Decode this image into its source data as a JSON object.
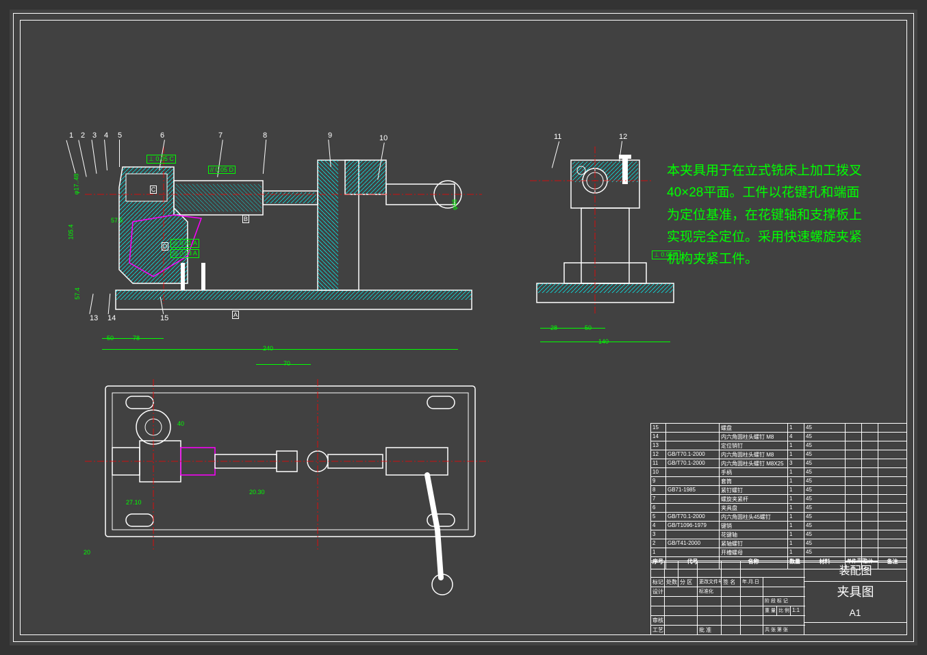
{
  "annotation": "本夹具用于在立式铣床上加工拨叉40×28平面。工件以花键孔和端面为定位基准，在花键轴和支撑板上实现完全定位。采用快速螺旋夹紧机构夹紧工件。",
  "balloons_top": [
    "1",
    "2",
    "3",
    "4",
    "5",
    "6",
    "7",
    "8",
    "9",
    "10",
    "11",
    "12"
  ],
  "balloons_bottom": [
    "13",
    "14",
    "15"
  ],
  "gd_refs": {
    "A": "A",
    "B": "B",
    "C": "C",
    "D": "D"
  },
  "tolerances": {
    "t1": "⊥ 0.05 C",
    "t2": "// 0.05 D",
    "t3": "◎ 0.01 A",
    "t4": "◎ 0.03 A",
    "t5": "⊥ 0.05 A"
  },
  "dimensions": {
    "d1": "57.5",
    "d2": "27.10",
    "d3": "105.4",
    "d4": "57.4",
    "d5": "50",
    "d6": "78",
    "d7": "240",
    "d8": "20",
    "d9": "70",
    "d10": "20.30",
    "d11": "27.10",
    "d12": "40",
    "d13": "28",
    "d14": "50",
    "d15": "140",
    "d16": "φ17..48",
    "d17": "φ48"
  },
  "bom": [
    {
      "no": "15",
      "code": "",
      "name": "螺盘",
      "qty": "1",
      "mat": "45"
    },
    {
      "no": "14",
      "code": "",
      "name": "内六角圆柱头螺钉 M8",
      "qty": "4",
      "mat": "45"
    },
    {
      "no": "13",
      "code": "",
      "name": "定位销钉",
      "qty": "1",
      "mat": "45"
    },
    {
      "no": "12",
      "code": "GB/T70.1-2000",
      "name": "内六角圆柱头螺钉 M8",
      "qty": "1",
      "mat": "45"
    },
    {
      "no": "11",
      "code": "GB/T70.1-2000",
      "name": "内六角圆柱头螺钉 M8X25",
      "qty": "3",
      "mat": "45"
    },
    {
      "no": "10",
      "code": "",
      "name": "手柄",
      "qty": "1",
      "mat": "45"
    },
    {
      "no": "9",
      "code": "",
      "name": "套筒",
      "qty": "1",
      "mat": "45"
    },
    {
      "no": "8",
      "code": "GB71-1985",
      "name": "紧钉螺钉",
      "qty": "1",
      "mat": "45"
    },
    {
      "no": "7",
      "code": "",
      "name": "螺旋夹紧杆",
      "qty": "1",
      "mat": "45"
    },
    {
      "no": "6",
      "code": "",
      "name": "夹具盘",
      "qty": "1",
      "mat": "45"
    },
    {
      "no": "5",
      "code": "GB/T70.1-2000",
      "name": "内六角圆柱头45螺钉",
      "qty": "1",
      "mat": "45"
    },
    {
      "no": "4",
      "code": "GB/T1096-1979",
      "name": "键销",
      "qty": "1",
      "mat": "45"
    },
    {
      "no": "3",
      "code": "",
      "name": "花键轴",
      "qty": "1",
      "mat": "45"
    },
    {
      "no": "2",
      "code": "GB/T41-2000",
      "name": "紧轴螺钉",
      "qty": "1",
      "mat": "45"
    },
    {
      "no": "1",
      "code": "",
      "name": "开槽螺母",
      "qty": "1",
      "mat": "45"
    }
  ],
  "bom_headers": {
    "no": "序号",
    "code": "代号",
    "name": "名称",
    "qty": "数量",
    "mat": "材料",
    "single": "单件",
    "total": "总计",
    "wt": "重量",
    "remark": "备注"
  },
  "title_block": {
    "main_title": "装配图",
    "drawing_name": "夹具图",
    "sheet": "A1",
    "marks_label": "标记",
    "loc_label": "处数",
    "section_label": "分 区",
    "doc_label": "更改文件号",
    "sign_label": "签 名",
    "date_label": "年.月.日",
    "design_label": "设计",
    "std_label": "标准化",
    "stage_label": "阶 段 标 记",
    "weight_label": "重 量",
    "scale_label": "比 例",
    "scale_val": "1:1",
    "check_label": "审核",
    "process_label": "工艺",
    "approve_label": "批 准",
    "sheet_label": "共  张  第  张"
  }
}
